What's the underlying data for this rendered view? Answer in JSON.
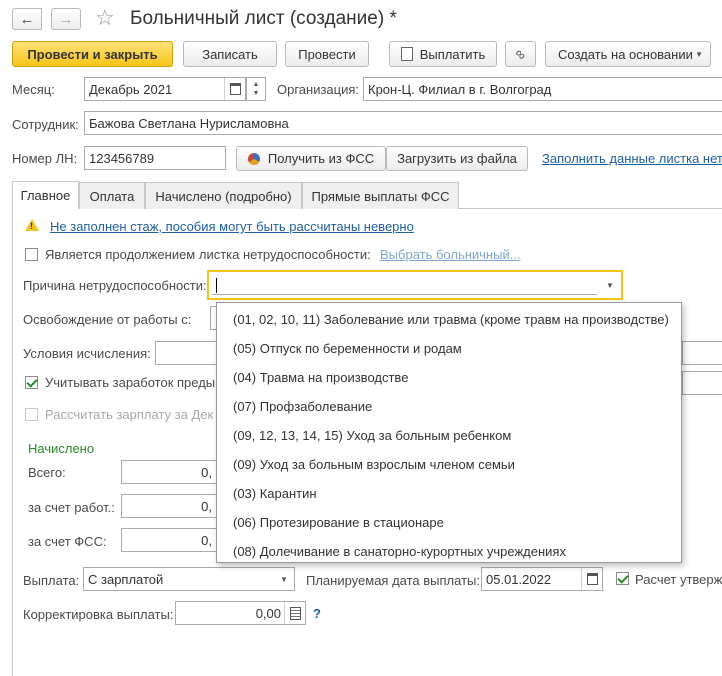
{
  "window": {
    "title": "Больничный лист (создание) *"
  },
  "toolbar": {
    "post_close": "Провести и закрыть",
    "save": "Записать",
    "post": "Провести",
    "pay": "Выплатить",
    "create_based": "Создать на основании"
  },
  "header": {
    "month_label": "Месяц:",
    "month_value": "Декабрь 2021",
    "org_label": "Организация:",
    "org_value": "Крон-Ц. Филиал в г. Волгоград",
    "employee_label": "Сотрудник:",
    "employee_value": "Бажова Светлана Нурисламовна",
    "ln_label": "Номер ЛН:",
    "ln_value": "123456789",
    "get_fss": "Получить из ФСС",
    "load_file": "Загрузить из файла",
    "fill_link": "Заполнить данные листка нетр"
  },
  "tabs": [
    {
      "label": "Главное"
    },
    {
      "label": "Оплата"
    },
    {
      "label": "Начислено (подробно)"
    },
    {
      "label": "Прямые выплаты ФСС"
    }
  ],
  "main": {
    "warning": "Не заполнен стаж, пособия могут быть рассчитаны неверно",
    "continuation_label": "Является продолжением листка нетрудоспособности:",
    "choose_sick": "Выбрать больничный...",
    "reason_label": "Причина нетрудоспособности:",
    "release_label": "Освобождение от работы с:",
    "conditions_label": "Условия исчисления:",
    "consider_earnings": "Учитывать заработок преды",
    "calc_salary": "Рассчитать зарплату за Дек",
    "accrued_title": "Начислено",
    "total_label": "Всего:",
    "total_value": "0,",
    "employer_label": "за счет работ.:",
    "employer_value": "0,",
    "fss_label": "за счет ФСС:",
    "fss_value": "0,",
    "payment_label": "Выплата:",
    "payment_value": "С зарплатой",
    "planned_date_label": "Планируемая дата выплаты:",
    "planned_date_value": "05.01.2022",
    "calc_approved": "Расчет утвержд",
    "correction_label": "Корректировка выплаты:",
    "correction_value": "0,00",
    "help": "?"
  },
  "reason_options": [
    "(01, 02, 10, 11) Заболевание или травма (кроме травм на производстве)",
    "(05) Отпуск по беременности и родам",
    "(04) Травма на производстве",
    "(07) Профзаболевание",
    "(09, 12, 13, 14, 15) Уход за больным ребенком",
    "(09) Уход за больным взрослым членом семьи",
    "(03) Карантин",
    "(06) Протезирование в стационаре",
    "(08) Долечивание в санаторно-курортных учреждениях"
  ],
  "colors": {
    "primary_button": "#f5c518",
    "link": "#1f5fa8",
    "section": "#2a8a2a",
    "focus": "#f0c419"
  }
}
